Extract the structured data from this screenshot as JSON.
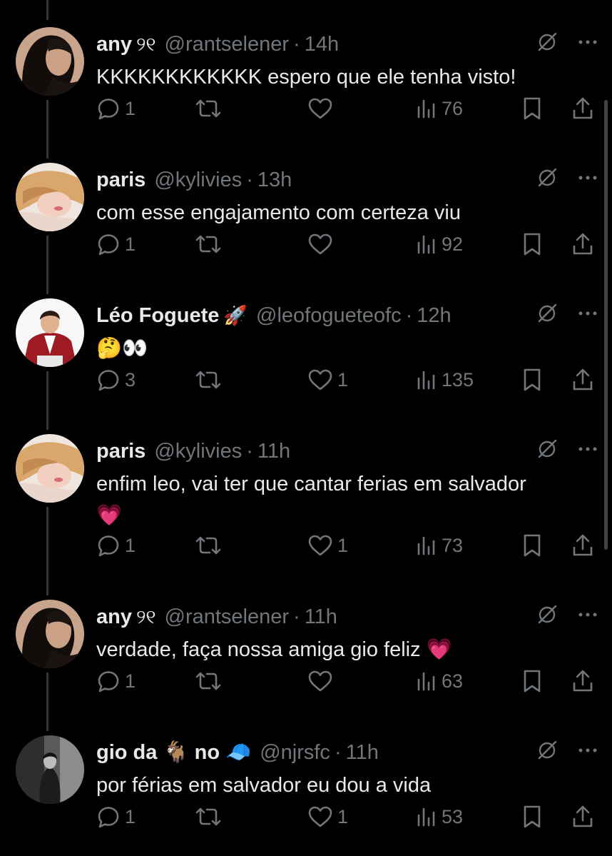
{
  "tweets": [
    {
      "name": "any",
      "name_emoji": "୨୧",
      "handle": "@rantselener",
      "time": "14h",
      "text": "KKKKKKKKKKKK espero que ele tenha visto!",
      "replies": "1",
      "retweets": "",
      "likes": "",
      "views": "76",
      "avatar": "dark-hair-woman"
    },
    {
      "name": "paris",
      "name_emoji": "",
      "handle": "@kylivies",
      "time": "13h",
      "text": "com esse engajamento com certeza viu",
      "replies": "1",
      "retweets": "",
      "likes": "",
      "views": "92",
      "avatar": "blonde-woman"
    },
    {
      "name": "Léo Foguete",
      "name_emoji": "🚀",
      "handle": "@leofogueteofc",
      "time": "12h",
      "text": "🤔👀",
      "replies": "3",
      "retweets": "",
      "likes": "1",
      "views": "135",
      "avatar": "man-red-jacket"
    },
    {
      "name": "paris",
      "name_emoji": "",
      "handle": "@kylivies",
      "time": "11h",
      "text": "enfim leo, vai ter que cantar ferias em salvador\n💗",
      "replies": "1",
      "retweets": "",
      "likes": "1",
      "views": "73",
      "avatar": "blonde-woman"
    },
    {
      "name": "any",
      "name_emoji": "୨୧",
      "handle": "@rantselener",
      "time": "11h",
      "text": "verdade, faça nossa amiga gio feliz 💗",
      "replies": "1",
      "retweets": "",
      "likes": "",
      "views": "63",
      "avatar": "dark-hair-woman"
    },
    {
      "name": "gio da 🐐 no 🧢",
      "name_emoji": "",
      "handle": "@njrsfc",
      "time": "11h",
      "text": "por férias em salvador eu dou a vida",
      "replies": "1",
      "retweets": "",
      "likes": "1",
      "views": "53",
      "avatar": "grayscale-portrait"
    }
  ],
  "separator": "·",
  "colors": {
    "background": "#000000",
    "text": "#e7e9ea",
    "secondary": "#71767b",
    "thread_line": "#333639"
  },
  "icons": [
    "reply-icon",
    "retweet-icon",
    "like-icon",
    "views-icon",
    "bookmark-icon",
    "share-icon",
    "mute-icon",
    "more-icon"
  ]
}
